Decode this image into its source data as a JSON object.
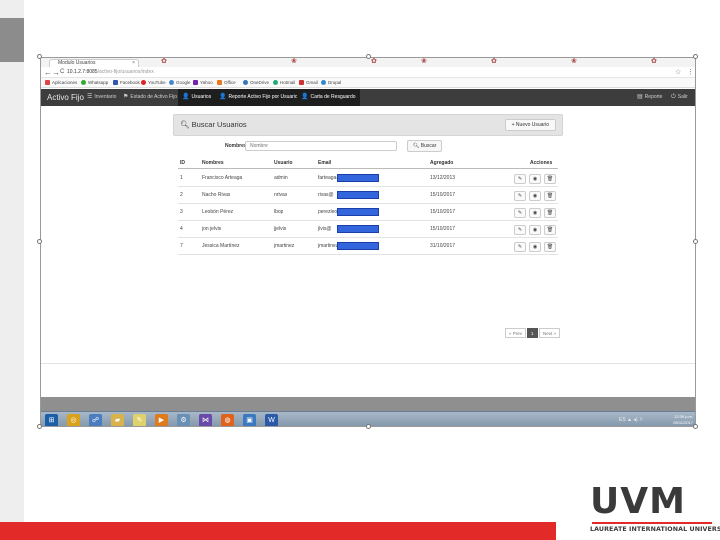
{
  "slide": {
    "logo": {
      "name": "UVM",
      "tagline": "LAUREATE INTERNATIONAL UNIVERSITIES®"
    },
    "colors": {
      "accent_red": "#e22a29",
      "nav_dark": "#3d3d3d",
      "redaction_blue": "#3366dd"
    }
  },
  "browser": {
    "tab_title": "Modulo Usuarios",
    "tab_close": "×",
    "nav_back": "←",
    "nav_forward": "→",
    "nav_reload": "C",
    "url": "10.1.2.7:8085",
    "url_path": "/activo-fijo/usuarios/index",
    "star": "☆",
    "menu": "⋮",
    "bookmarks": [
      {
        "label": "Aplicaciones",
        "icon": "apps-icon",
        "color": "#d44"
      },
      {
        "label": "Whatsapp",
        "icon": "whatsapp-icon",
        "color": "#3a3"
      },
      {
        "label": "Facebook",
        "icon": "facebook-icon",
        "color": "#35a"
      },
      {
        "label": "YouTube",
        "icon": "youtube-icon",
        "color": "#d22"
      },
      {
        "label": "Google",
        "icon": "google-icon",
        "color": "#48c"
      },
      {
        "label": "Yahoo",
        "icon": "yahoo-icon",
        "color": "#72a"
      },
      {
        "label": "Office",
        "icon": "office-icon",
        "color": "#e72"
      },
      {
        "label": "OneDrive",
        "icon": "onedrive-icon",
        "color": "#37b"
      },
      {
        "label": "Hotmail",
        "icon": "hotmail-icon",
        "color": "#2a7"
      },
      {
        "label": "Gmail",
        "icon": "gmail-icon",
        "color": "#c33"
      },
      {
        "label": "Drupal",
        "icon": "drupal-icon",
        "color": "#38c"
      }
    ]
  },
  "app": {
    "brand": "Activo Fijo",
    "nav": [
      {
        "label": "Inventario",
        "icon": "list-icon",
        "active": false
      },
      {
        "label": "Estado de Activo Fijo",
        "icon": "tag-icon",
        "active": false
      },
      {
        "label": "Usuarios",
        "icon": "user-icon",
        "active": true
      },
      {
        "label": "Reporte Activo Fijo por Usuario",
        "icon": "user-icon",
        "active": true
      },
      {
        "label": "Carta de Resguardo",
        "icon": "user-icon",
        "active": true
      }
    ],
    "nav_right": [
      {
        "label": "Reporte",
        "icon": "report-icon"
      },
      {
        "label": "Salir",
        "icon": "power-icon"
      }
    ],
    "panel": {
      "title": "Buscar Usuarios",
      "new_button": "Nuevo Usuario",
      "search_label": "Nombres:",
      "search_placeholder": "Nombre",
      "search_button": "Buscar"
    },
    "table": {
      "columns": [
        "ID",
        "Nombres",
        "Usuario",
        "Email",
        "Agregado",
        "Acciones"
      ],
      "rows": [
        {
          "id": "1",
          "nombres": "Francisco Arteaga",
          "usuario": "admin",
          "email": "farteaga@",
          "agregado": "13/12/2013"
        },
        {
          "id": "2",
          "nombres": "Nacho Rivas",
          "usuario": "nrivas",
          "email": "rivas@",
          "agregado": "15/10/2017"
        },
        {
          "id": "3",
          "nombres": "Leobón Pérez",
          "usuario": "lbop",
          "email": "perezleobon@",
          "agregado": "15/10/2017"
        },
        {
          "id": "4",
          "nombres": "jon jelvis",
          "usuario": "jjelvis",
          "email": "jlvis@",
          "agregado": "15/10/2017"
        },
        {
          "id": "7",
          "nombres": "Jessica Martínez",
          "usuario": "jmartinez",
          "email": "jmartinez@",
          "agregado": "31/10/2017"
        }
      ],
      "actions": [
        "edit-icon",
        "view-icon",
        "delete-icon"
      ]
    },
    "pager": {
      "prev": "« Prev",
      "current": "1",
      "next": "Next »"
    }
  },
  "taskbar": {
    "clock_time": "12:39 p.m.",
    "clock_date": "05/11/2017",
    "tray": "ES ▲ ◂) ⚐",
    "apps": [
      {
        "icon": "windows-start-icon",
        "color": "#1b5fa8"
      },
      {
        "icon": "chrome-icon",
        "color": "#d9a21b"
      },
      {
        "icon": "network-icon",
        "color": "#4a7cc0"
      },
      {
        "icon": "folder-icon",
        "color": "#d8b24a"
      },
      {
        "icon": "notes-icon",
        "color": "#e0d26a"
      },
      {
        "icon": "media-player-icon",
        "color": "#e07b1b"
      },
      {
        "icon": "tools-icon",
        "color": "#6a8fb5"
      },
      {
        "icon": "visual-studio-icon",
        "color": "#6a4aa8"
      },
      {
        "icon": "firefox-icon",
        "color": "#e0621b"
      },
      {
        "icon": "remote-desktop-icon",
        "color": "#3a78c0"
      },
      {
        "icon": "word-icon",
        "color": "#2a5aa8"
      }
    ]
  }
}
